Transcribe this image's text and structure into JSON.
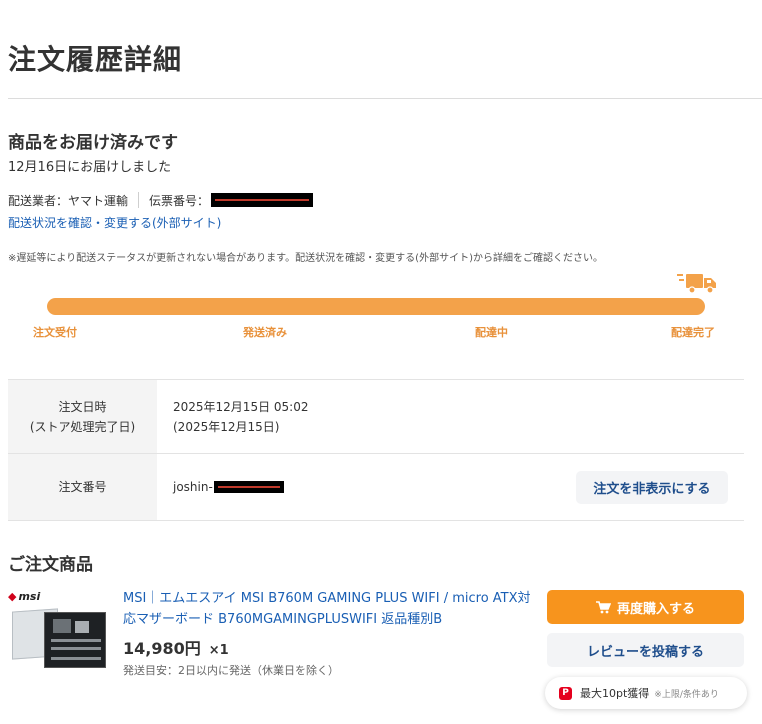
{
  "page": {
    "title": "注文履歴詳細"
  },
  "delivery": {
    "status_title": "商品をお届け済みです",
    "status_date": "12月16日にお届けしました",
    "carrier_label": "配送業者：ヤマト運輸",
    "tracking_label": "伝票番号：",
    "tracking_link": "配送状況を確認・変更する(外部サイト)",
    "notice": "※遅延等により配送ステータスが更新されない場合があります。配送状況を確認・変更する(外部サイト)から詳細をご確認ください。",
    "progress": 1.0,
    "steps": [
      "注文受付",
      "発送済み",
      "配達中",
      "配達完了"
    ],
    "truck_icon": "delivery-truck-icon",
    "accent_color": "#f3a24a"
  },
  "order_info": {
    "date_label_line1": "注文日時",
    "date_label_line2": "(ストア処理完了日)",
    "date_value_line1": "2025年12月15日 05:02",
    "date_value_line2": "(2025年12月15日)",
    "number_label": "注文番号",
    "number_prefix": "joshin-",
    "hide_button": "注文を非表示にする"
  },
  "products": {
    "section_title": "ご注文商品",
    "items": [
      {
        "title": "MSI｜エムエスアイ MSI B760M GAMING PLUS WIFI / micro ATX対応マザーボード B760MGAMINGPLUSWIFI 返品種別B",
        "brand": "msi",
        "price": "14,980円",
        "quantity": "×1",
        "ship_estimate": "発送目安：2日以内に発送（休業日を除く）",
        "rebuy_button": "再度購入する",
        "review_button": "レビューを投稿する",
        "points_text": "最大10pt獲得",
        "points_note": "※上限/条件あり",
        "points_icon": "P"
      }
    ]
  }
}
